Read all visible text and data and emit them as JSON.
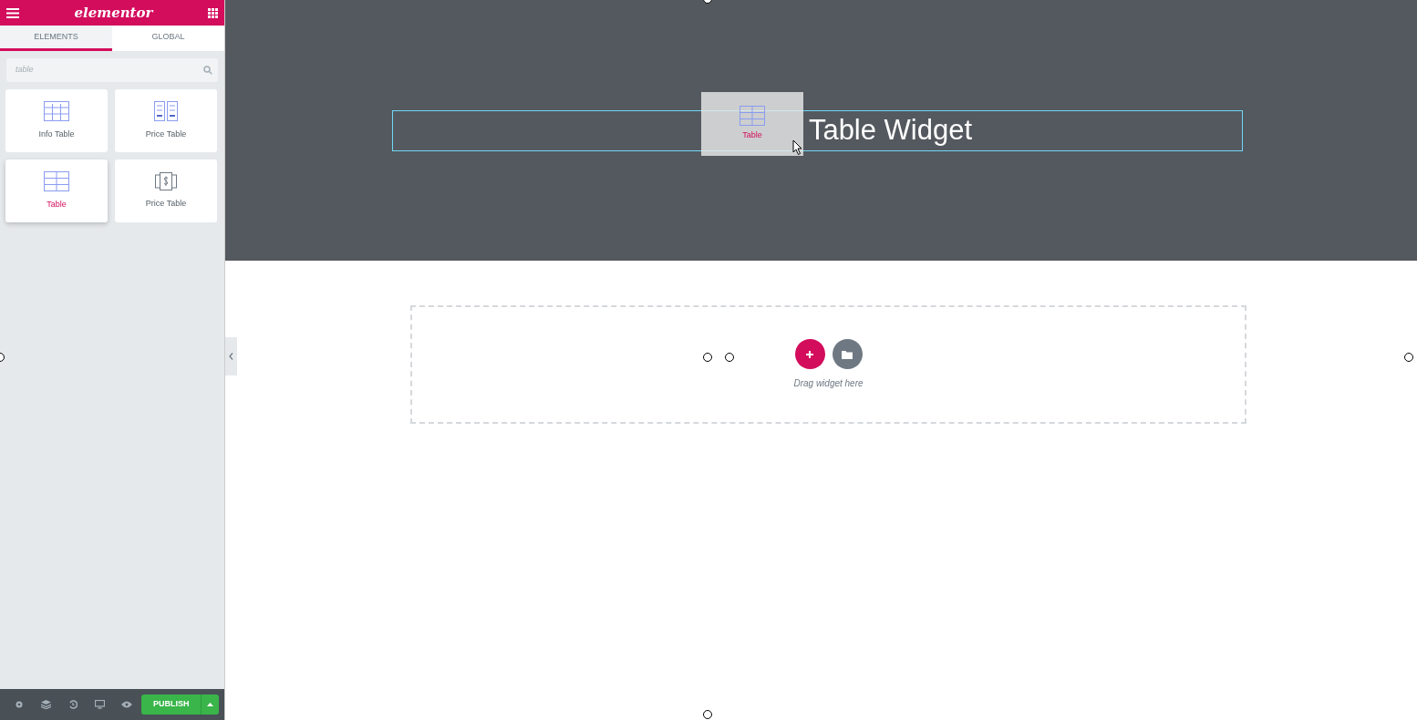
{
  "header": {
    "logo": "elementor"
  },
  "tabs": [
    {
      "label": "ELEMENTS",
      "selected": true
    },
    {
      "label": "GLOBAL",
      "selected": false
    }
  ],
  "search": {
    "placeholder": "table"
  },
  "widgets": [
    {
      "label": "Info Table",
      "kind": "grid",
      "selected": false
    },
    {
      "label": "Price Table",
      "kind": "columns",
      "selected": false
    },
    {
      "label": "Table",
      "kind": "table",
      "selected": true
    },
    {
      "label": "Price Table",
      "kind": "dollar",
      "selected": false
    }
  ],
  "footer": {
    "publish": "PUBLISH"
  },
  "canvas": {
    "heading": "Table Widget",
    "drag_ghost": {
      "label": "Table",
      "kind": "table"
    },
    "drop_zone": {
      "hint": "Drag widget here"
    }
  }
}
